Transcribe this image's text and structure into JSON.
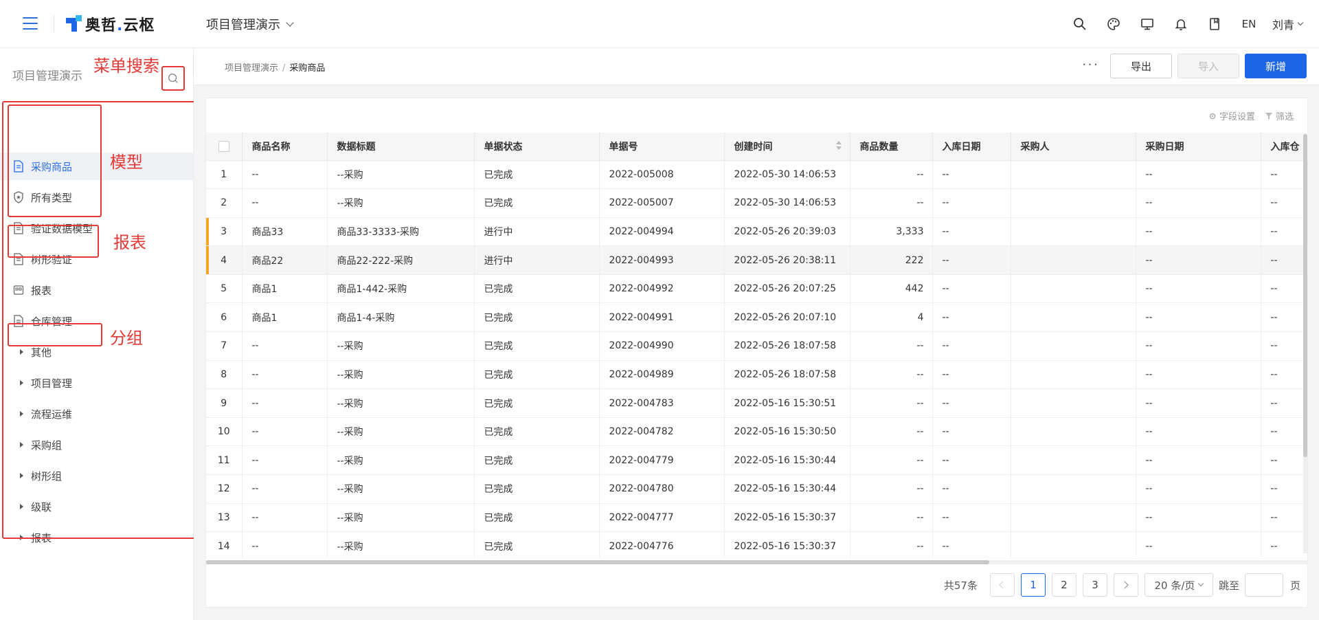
{
  "topbar": {
    "brand_main": "奥哲",
    "brand_dot": ".",
    "brand_sub": "云枢",
    "project": "项目管理演示",
    "lang": "EN",
    "user": "刘青",
    "icons": [
      "search-icon",
      "palette-icon",
      "monitor-icon",
      "bell-icon",
      "book-icon"
    ]
  },
  "sidebar": {
    "title": "项目管理演示",
    "items": [
      {
        "label": "采购商品",
        "icon": "doc-icon",
        "active": true
      },
      {
        "label": "所有类型",
        "icon": "shield-icon"
      },
      {
        "label": "验证数据模型",
        "icon": "doc-icon"
      },
      {
        "label": "树形验证",
        "icon": "doc-icon"
      },
      {
        "label": "报表",
        "icon": "report-icon"
      },
      {
        "label": "仓库管理",
        "icon": "doc-icon"
      },
      {
        "label": "其他",
        "group": true
      },
      {
        "label": "项目管理",
        "group": true
      },
      {
        "label": "流程运维",
        "group": true
      },
      {
        "label": "采购组",
        "group": true
      },
      {
        "label": "树形组",
        "group": true
      },
      {
        "label": "级联",
        "group": true
      },
      {
        "label": "报表",
        "group": true
      }
    ]
  },
  "annotations": {
    "menu_search": "菜单搜索",
    "model": "模型",
    "report": "报表",
    "group": "分组",
    "color": "#e53935"
  },
  "breadcrumb": {
    "parent": "项目管理演示",
    "sep": "/",
    "current": "采购商品"
  },
  "actions": {
    "more": "···",
    "export": "导出",
    "import": "导入",
    "new": "新增"
  },
  "toolbar": {
    "field_settings": "字段设置",
    "filter": "筛选"
  },
  "table": {
    "columns": [
      "商品名称",
      "数据标题",
      "单据状态",
      "单据号",
      "创建时间",
      "商品数量",
      "入库日期",
      "采购人",
      "采购日期",
      "入库仓"
    ],
    "rows": [
      {
        "idx": "1",
        "name": "--",
        "title": "--采购",
        "status": "已完成",
        "no": "2022-005008",
        "time": "2022-05-30 14:06:53",
        "qty": "--",
        "in_date": "--",
        "buyer": "",
        "buy_date": "--",
        "wh": "--"
      },
      {
        "idx": "2",
        "name": "--",
        "title": "--采购",
        "status": "已完成",
        "no": "2022-005007",
        "time": "2022-05-30 14:06:53",
        "qty": "--",
        "in_date": "--",
        "buyer": "",
        "buy_date": "--",
        "wh": "--"
      },
      {
        "idx": "3",
        "name": "商品33",
        "title": "商品33-3333-采购",
        "status": "进行中",
        "no": "2022-004994",
        "time": "2022-05-26 20:39:03",
        "qty": "3,333",
        "in_date": "--",
        "buyer": "",
        "buy_date": "--",
        "wh": "--",
        "flag": true
      },
      {
        "idx": "4",
        "name": "商品22",
        "title": "商品22-222-采购",
        "status": "进行中",
        "no": "2022-004993",
        "time": "2022-05-26 20:38:11",
        "qty": "222",
        "in_date": "--",
        "buyer": "",
        "buy_date": "--",
        "wh": "--",
        "flag": true,
        "hl": true
      },
      {
        "idx": "5",
        "name": "商品1",
        "title": "商品1-442-采购",
        "status": "已完成",
        "no": "2022-004992",
        "time": "2022-05-26 20:07:25",
        "qty": "442",
        "in_date": "--",
        "buyer": "",
        "buy_date": "--",
        "wh": "--"
      },
      {
        "idx": "6",
        "name": "商品1",
        "title": "商品1-4-采购",
        "status": "已完成",
        "no": "2022-004991",
        "time": "2022-05-26 20:07:10",
        "qty": "4",
        "in_date": "--",
        "buyer": "",
        "buy_date": "--",
        "wh": "--"
      },
      {
        "idx": "7",
        "name": "--",
        "title": "--采购",
        "status": "已完成",
        "no": "2022-004990",
        "time": "2022-05-26 18:07:58",
        "qty": "--",
        "in_date": "--",
        "buyer": "",
        "buy_date": "--",
        "wh": "--"
      },
      {
        "idx": "8",
        "name": "--",
        "title": "--采购",
        "status": "已完成",
        "no": "2022-004989",
        "time": "2022-05-26 18:07:58",
        "qty": "--",
        "in_date": "--",
        "buyer": "",
        "buy_date": "--",
        "wh": "--"
      },
      {
        "idx": "9",
        "name": "--",
        "title": "--采购",
        "status": "已完成",
        "no": "2022-004783",
        "time": "2022-05-16 15:30:51",
        "qty": "--",
        "in_date": "--",
        "buyer": "",
        "buy_date": "--",
        "wh": "--"
      },
      {
        "idx": "10",
        "name": "--",
        "title": "--采购",
        "status": "已完成",
        "no": "2022-004782",
        "time": "2022-05-16 15:30:50",
        "qty": "--",
        "in_date": "--",
        "buyer": "",
        "buy_date": "--",
        "wh": "--"
      },
      {
        "idx": "11",
        "name": "--",
        "title": "--采购",
        "status": "已完成",
        "no": "2022-004779",
        "time": "2022-05-16 15:30:44",
        "qty": "--",
        "in_date": "--",
        "buyer": "",
        "buy_date": "--",
        "wh": "--"
      },
      {
        "idx": "12",
        "name": "--",
        "title": "--采购",
        "status": "已完成",
        "no": "2022-004780",
        "time": "2022-05-16 15:30:44",
        "qty": "--",
        "in_date": "--",
        "buyer": "",
        "buy_date": "--",
        "wh": "--"
      },
      {
        "idx": "13",
        "name": "--",
        "title": "--采购",
        "status": "已完成",
        "no": "2022-004777",
        "time": "2022-05-16 15:30:37",
        "qty": "--",
        "in_date": "--",
        "buyer": "",
        "buy_date": "--",
        "wh": "--"
      },
      {
        "idx": "14",
        "name": "--",
        "title": "--采购",
        "status": "已完成",
        "no": "2022-004776",
        "time": "2022-05-16 15:30:37",
        "qty": "--",
        "in_date": "--",
        "buyer": "",
        "buy_date": "--",
        "wh": "--"
      }
    ]
  },
  "pager": {
    "total": "共57条",
    "pages": [
      "1",
      "2",
      "3"
    ],
    "current": "1",
    "page_size": "20 条/页",
    "jump_label": "跳至",
    "page_unit": "页"
  },
  "colors": {
    "primary": "#1e66e8",
    "flag": "#f5a623",
    "annotation": "#e53935"
  }
}
